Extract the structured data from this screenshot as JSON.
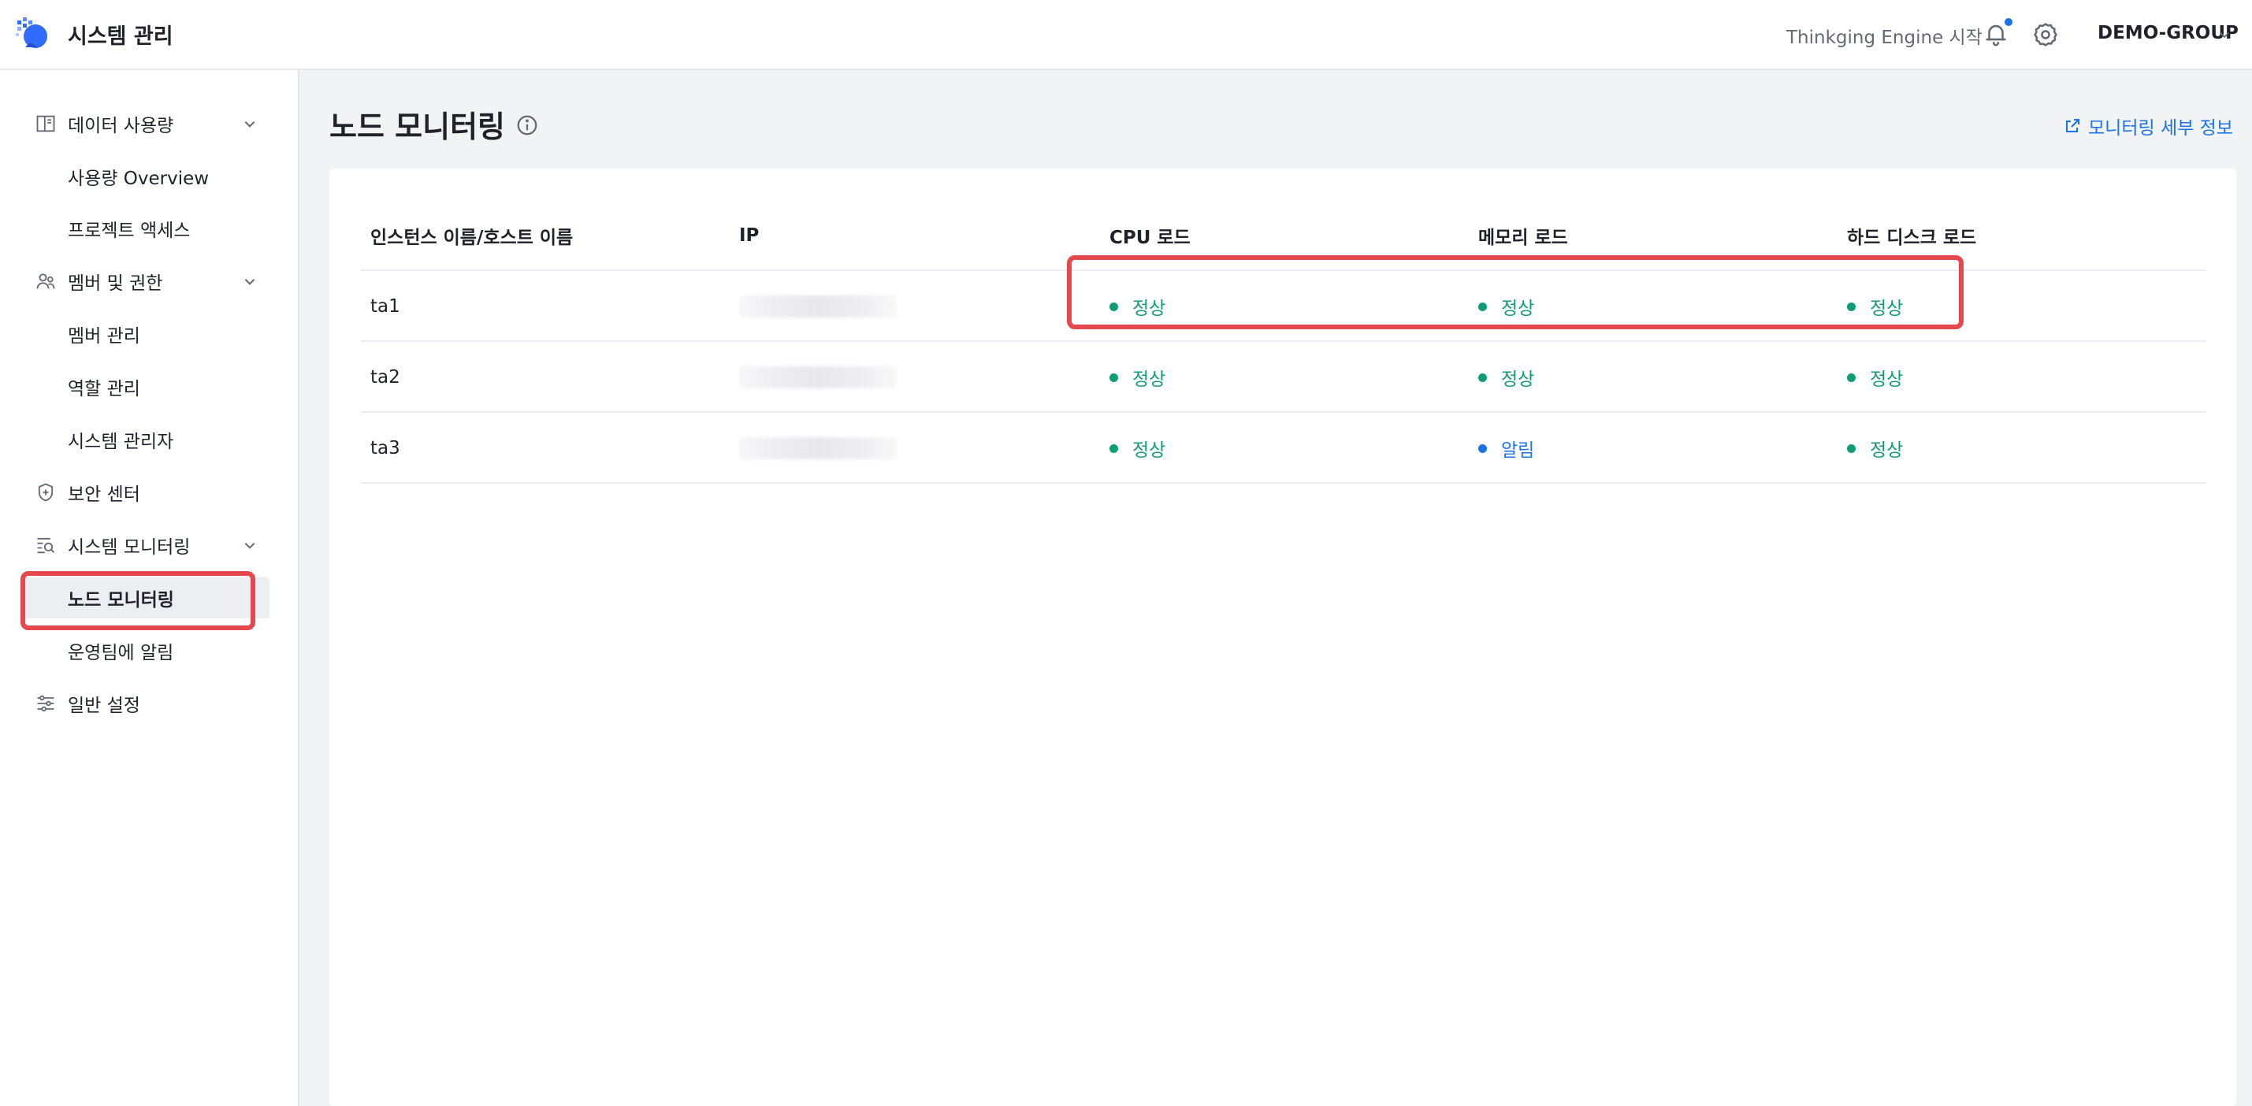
{
  "header": {
    "app_title": "시스템 관리",
    "start_link": "Thinkging Engine 시작",
    "group": "DEMO-GROUP"
  },
  "sidebar": {
    "groups": [
      {
        "label": "데이터 사용량",
        "icon": "book-icon",
        "items": [
          "사용량 Overview",
          "프로젝트 액세스"
        ]
      },
      {
        "label": "멤버 및 권한",
        "icon": "users-icon",
        "items": [
          "멤버 관리",
          "역할 관리",
          "시스템 관리자"
        ]
      },
      {
        "label": "보안 센터",
        "icon": "shield-icon"
      },
      {
        "label": "시스템 모니터링",
        "icon": "monitor-search-icon",
        "items": [
          "노드 모니터링",
          "운영팀에 알림"
        ]
      },
      {
        "label": "일반 설정",
        "icon": "sliders-icon"
      }
    ],
    "active_item": "노드 모니터링"
  },
  "main": {
    "title": "노드 모니터링",
    "detail_link": "모니터링 세부 정보",
    "table": {
      "headers": [
        "인스턴스 이름/호스트 이름",
        "IP",
        "CPU 로드",
        "메모리 로드",
        "하드 디스크 로드"
      ],
      "rows": [
        {
          "name": "ta1",
          "cpu": "정상",
          "memory": "정상",
          "disk": "정상"
        },
        {
          "name": "ta2",
          "cpu": "정상",
          "memory": "정상",
          "disk": "정상"
        },
        {
          "name": "ta3",
          "cpu": "정상",
          "memory": "알림",
          "disk": "정상"
        }
      ]
    }
  },
  "colors": {
    "accent": "#1a73e8",
    "ok": "#0f9d76",
    "highlight": "#e5484d"
  }
}
